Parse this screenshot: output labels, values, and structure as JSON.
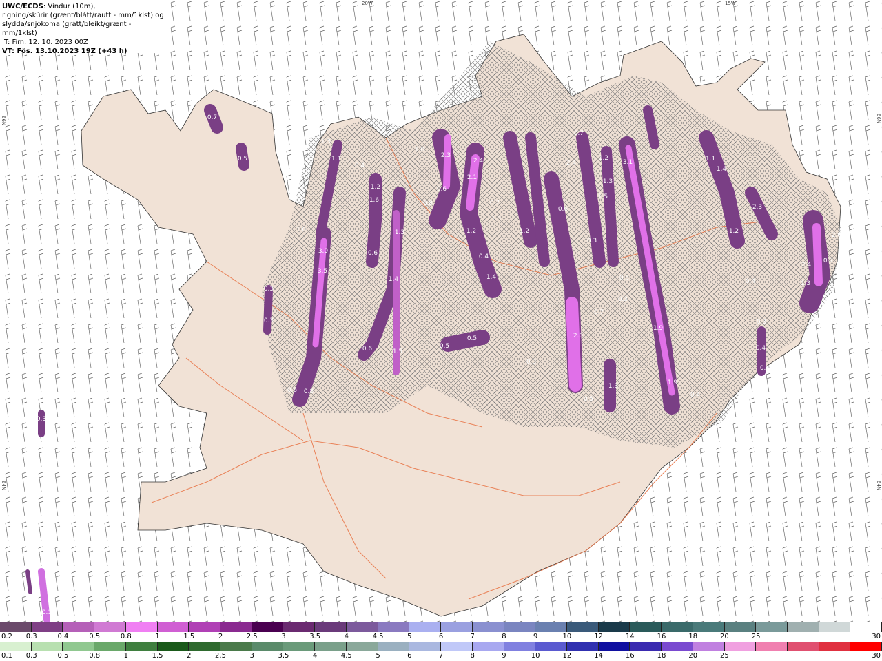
{
  "header": {
    "product": "UWC/ECDS",
    "line1_rest": ": Vindur (10m),",
    "line2": "rigning/skúrir (grænt/blátt/rautt - mm/1klst) og",
    "line3": "slydda/snjókoma (grátt/bleikt/grænt - mm/1klst)",
    "line4": "IT: Fim. 12. 10. 2023 00Z",
    "line5": "VT: Fös. 13.10.2023 19Z (+43 h)"
  },
  "grid_labels": {
    "top_20w": "20W",
    "top_15w": "15W",
    "left_66n": "66N",
    "right_66n": "66N",
    "left_64n": "64N",
    "right_64n": "64N"
  },
  "snow_scale": {
    "colors": [
      "#6b4a6b",
      "#7f3f85",
      "#b560b8",
      "#d07ad3",
      "#f07ff3",
      "#d05fd3",
      "#b040b5",
      "#8a2a90",
      "#4a0050",
      "#6a2a70",
      "#6a3a7a",
      "#7c5a9c",
      "#8a7ac0",
      "#aab0f0",
      "#9aa0e0",
      "#8a90d0",
      "#7a85c0",
      "#6a80b0",
      "#3a5a7a",
      "#1a3a4a",
      "#2a5a5a",
      "#3a6a6a",
      "#4a7a7a",
      "#5a8080",
      "#7a9a9a",
      "#a0b0b0",
      "#d0d8d8",
      "#ffffff"
    ],
    "ticks": [
      "0.2",
      "0.3",
      "0.4",
      "0.5",
      "0.8",
      "1",
      "1.5",
      "2",
      "2.5",
      "3",
      "3.5",
      "4",
      "4.5",
      "5",
      "6",
      "7",
      "8",
      "9",
      "10",
      "12",
      "14",
      "16",
      "18",
      "20",
      "25",
      "30"
    ]
  },
  "rain_scale": {
    "colors": [
      "#d8f0d0",
      "#b8e0b0",
      "#90c890",
      "#6aa86a",
      "#3f7f3f",
      "#1a5a1a",
      "#2e6a2e",
      "#4a7a4a",
      "#5a8a6a",
      "#6a9a7a",
      "#7aa08a",
      "#8aa89a",
      "#9ab0c0",
      "#aab8e0",
      "#c0c8f8",
      "#a8a8f0",
      "#8080e0",
      "#5a5ad0",
      "#3030b0",
      "#1010a0",
      "#3a2ab0",
      "#7a4ad0",
      "#c080e0",
      "#f0a0e0",
      "#f080b0",
      "#e05070",
      "#e03040",
      "#ff0000"
    ],
    "ticks": [
      "0.1",
      "0.3",
      "0.5",
      "0.8",
      "1",
      "1.5",
      "2",
      "2.5",
      "3",
      "3.5",
      "4",
      "4.5",
      "5",
      "6",
      "7",
      "8",
      "9",
      "10",
      "12",
      "14",
      "16",
      "18",
      "20",
      "25",
      "30"
    ]
  },
  "precip_labels": [
    "0.7",
    "0.5",
    "1.1",
    "1.3",
    "0.4",
    "1.0",
    "2.3",
    "2.1",
    "2.4",
    "0.8",
    "1.2",
    "1.6",
    "1.3",
    "0.6",
    "1.4",
    "1.2",
    "3.0",
    "3.5",
    "0.3",
    "0.3",
    "0.6",
    "0.8",
    "0.6",
    "1.5",
    "0.5",
    "0.5",
    "1.4",
    "0.4",
    "1.3",
    "0.6",
    "0.7",
    "1.2",
    "0.7",
    "2.4",
    "1.2",
    "1.3",
    "1.5",
    "3.1",
    "1.1",
    "1.4",
    "2.3",
    "1.2",
    "2.0",
    "2.4",
    "0.7",
    "1.3",
    "0.4",
    "0.3",
    "0.4",
    "0.4",
    "2.0",
    "0.7",
    "0.3",
    "0.5",
    "1.3",
    "1.9",
    "0.4",
    "1.9",
    "0.3",
    "0.3",
    "0.6",
    "0.5",
    "0.3",
    "1.0",
    "0.1"
  ]
}
